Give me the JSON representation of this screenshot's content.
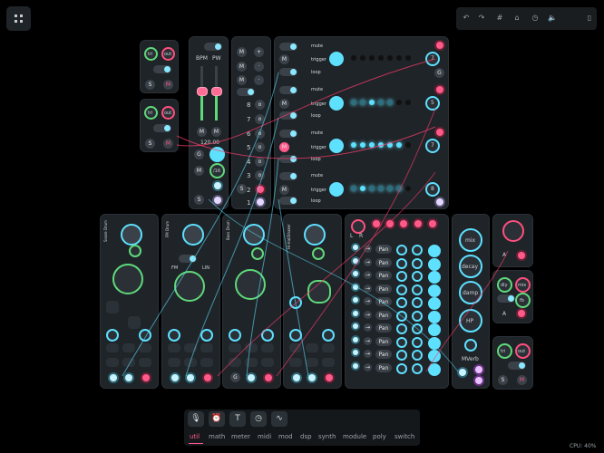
{
  "top_toolbar": {
    "icons": [
      "undo-icon",
      "redo-icon",
      "grid-icon",
      "lock-icon",
      "clock-icon",
      "volume-icon",
      "panel-icon"
    ]
  },
  "osc_mini": [
    {
      "tri": "tri",
      "out": "out",
      "s": "S",
      "m": "M"
    },
    {
      "tri": "tri",
      "out": "out",
      "s": "S",
      "m": "M"
    }
  ],
  "clock": {
    "bpm": "BPM",
    "pw": "PW",
    "m1": "M",
    "m2": "M",
    "tempo": "120.00",
    "g": "G",
    "m": "M",
    "s": "S",
    "div": "/16"
  },
  "divider": {
    "m_labels": [
      "M",
      "M",
      "M"
    ],
    "nums": [
      "8",
      "7",
      "6",
      "5",
      "4",
      "3",
      "2",
      "1"
    ],
    "s": "S"
  },
  "sequencer": {
    "rows": [
      {
        "mute": "mute",
        "trigger": "trigger",
        "loop": "loop",
        "m": "M",
        "step": "7",
        "g": "G"
      },
      {
        "mute": "mute",
        "trigger": "trigger",
        "loop": "loop",
        "m": "M",
        "step": "5"
      },
      {
        "mute": "mute",
        "trigger": "trigger",
        "loop": "loop",
        "m": "M",
        "step": "7"
      },
      {
        "mute": "mute",
        "trigger": "trigger",
        "loop": "loop",
        "m": "M",
        "step": "8"
      }
    ]
  },
  "drums": [
    {
      "title": "Snare Drum"
    },
    {
      "title": "FM Drum",
      "fm": "FM",
      "lin": "LIN"
    },
    {
      "title": "Bass Drum"
    },
    {
      "title": "Hi-Hat/Shaker"
    }
  ],
  "mixer": {
    "l": "L",
    "r": "R",
    "pan_label": "Pan",
    "pan_rows": 10
  },
  "reverb": {
    "mix": "mix",
    "decay": "decay",
    "damp": "damp",
    "hp": "HP",
    "title": "MVerb"
  },
  "right_mods": {
    "a1": "A",
    "a2": "A",
    "dly": "dly",
    "mix": "mix",
    "fb": "fb",
    "tri": "tri",
    "out": "out",
    "s": "S",
    "m": "M"
  },
  "bottom_bar": {
    "categories": [
      "util",
      "math",
      "meter",
      "midi",
      "mod",
      "dsp",
      "synth",
      "module",
      "poly",
      "switch"
    ],
    "active": "util"
  },
  "status": {
    "cpu": "CPU: 40%"
  }
}
